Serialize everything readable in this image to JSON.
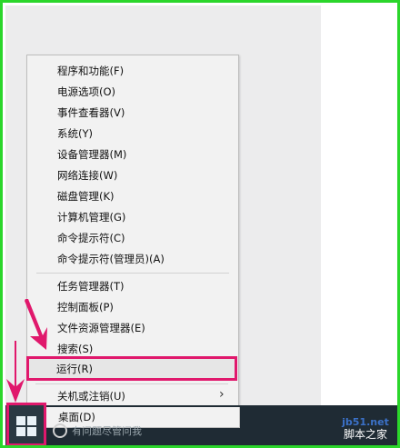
{
  "menu": {
    "items": [
      {
        "label": "程序和功能(F)"
      },
      {
        "label": "电源选项(O)"
      },
      {
        "label": "事件查看器(V)"
      },
      {
        "label": "系统(Y)"
      },
      {
        "label": "设备管理器(M)"
      },
      {
        "label": "网络连接(W)"
      },
      {
        "label": "磁盘管理(K)"
      },
      {
        "label": "计算机管理(G)"
      },
      {
        "label": "命令提示符(C)"
      },
      {
        "label": "命令提示符(管理员)(A)"
      },
      {
        "label": "任务管理器(T)"
      },
      {
        "label": "控制面板(P)"
      },
      {
        "label": "文件资源管理器(E)"
      },
      {
        "label": "搜索(S)"
      },
      {
        "label": "运行(R)"
      },
      {
        "label": "关机或注销(U)"
      },
      {
        "label": "桌面(D)"
      }
    ],
    "submenu_chevron": "›",
    "highlighted_item": "运行(R)"
  },
  "taskbar": {
    "search_placeholder": "有问题尽管问我",
    "start_icon": "windows-logo-icon"
  },
  "watermark": {
    "site": "jb51.net",
    "name": "脚本之家"
  },
  "colors": {
    "frame": "#2bd62b",
    "highlight": "#e0186c",
    "taskbar": "#1f2b34"
  }
}
